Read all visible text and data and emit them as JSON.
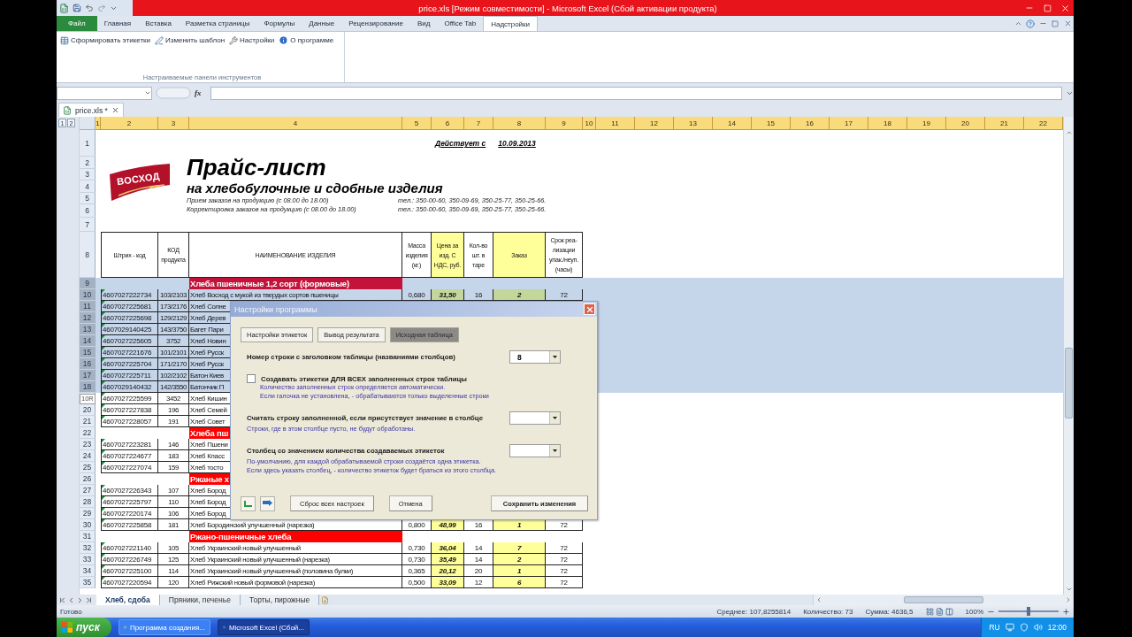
{
  "title_bar": {
    "title": "price.xls [Режим совместимости] - Microsoft Excel (Сбой активации продукта)"
  },
  "ribbon": {
    "tabs": [
      {
        "label": "Файл",
        "kind": "file",
        "selected": false
      },
      {
        "label": "Главная",
        "kind": "tab",
        "selected": false
      },
      {
        "label": "Вставка",
        "kind": "tab",
        "selected": false
      },
      {
        "label": "Разметка страницы",
        "kind": "tab",
        "selected": false
      },
      {
        "label": "Формулы",
        "kind": "tab",
        "selected": false
      },
      {
        "label": "Данные",
        "kind": "tab",
        "selected": false
      },
      {
        "label": "Рецензирование",
        "kind": "tab",
        "selected": false
      },
      {
        "label": "Вид",
        "kind": "tab",
        "selected": false
      },
      {
        "label": "Office Tab",
        "kind": "tab",
        "selected": false
      },
      {
        "label": "Надстройки",
        "kind": "tab",
        "selected": true
      }
    ],
    "commands": [
      {
        "label": "Сформировать этикетки",
        "kind": "table"
      },
      {
        "label": "Изменить шаблон",
        "kind": "edit"
      },
      {
        "label": "Настройки",
        "kind": "settings"
      },
      {
        "label": "О программе",
        "kind": "info"
      }
    ],
    "group_label": "Настраиваемые панели инструментов"
  },
  "formula_bar": {
    "function_label": "fx"
  },
  "doc_tabs": [
    {
      "label": "price.xls *",
      "selected": true
    }
  ],
  "sheet": {
    "outline_levels": [
      "1",
      "2"
    ],
    "columns": [
      "1",
      "2",
      "3",
      "4",
      "5",
      "6",
      "7",
      "8",
      "9",
      "10",
      "11",
      "12",
      "13",
      "14",
      "15",
      "16",
      "17",
      "18",
      "19",
      "20",
      "21",
      "22"
    ],
    "header_block": {
      "row_numbers": [
        "1",
        "2",
        "3",
        "4",
        "5",
        "6",
        "7"
      ],
      "effective_label": "Действует с",
      "effective_date": "10.09.2013",
      "logo_text": "ВОСХОД",
      "title": "Прайс-лист",
      "subtitle": "на хлебобулочные и сдобные изделия",
      "info_lines": [
        {
          "text": "Прием заказов на продукцию (с 08.00 до 18.00)",
          "phones": "тел.: 350-00-60, 350-09-69, 350-25-77, 350-25-66."
        },
        {
          "text": "Корректировка заказов на продукцию (с 08.00 до 18.00)",
          "phones": "тел.: 350-00-60, 350-09-69, 350-25-77, 350-25-66."
        }
      ]
    },
    "table_header": {
      "row_number": "8",
      "cells": [
        "Штрих - код",
        "КОД продукта",
        "НАИМЕНОВАНИЕ ИЗДЕЛИЯ",
        "Масса изделия (кг.)",
        "Цена за изд. С НДС, руб.",
        "Кол-во шт. в таре",
        "Заказ",
        "Срок реа-лизации упак./неуп. (часы)"
      ]
    },
    "rows": [
      {
        "number": "9",
        "selected": true,
        "kind": "category",
        "name": "Хлеба пшеничные 1,2 сорт (формовые)"
      },
      {
        "number": "10",
        "selected": true,
        "kind": "item",
        "barcode": "4607027222734",
        "code": "103/2103",
        "name": "Хлеб Восход с мукой из твердых сортов пшеницы",
        "mass": "0,680",
        "price": "31,50",
        "pack": "16",
        "order": "2",
        "shelf_life": "72"
      },
      {
        "number": "11",
        "selected": true,
        "kind": "item",
        "barcode": "4607027225681",
        "code": "173/2176",
        "name": "Хлеб Солне"
      },
      {
        "number": "12",
        "selected": true,
        "kind": "item",
        "barcode": "4607027225698",
        "code": "129/2129",
        "name": "Хлеб Дерев"
      },
      {
        "number": "13",
        "selected": true,
        "kind": "item",
        "barcode": "4607029140425",
        "code": "143/3750",
        "name": "Багет Пари"
      },
      {
        "number": "14",
        "selected": true,
        "kind": "item",
        "barcode": "4607027225605",
        "code": "3752",
        "name": "Хлеб Новин"
      },
      {
        "number": "15",
        "selected": true,
        "kind": "item",
        "barcode": "4607027221676",
        "code": "101/2101",
        "name": "Хлеб Русск"
      },
      {
        "number": "16",
        "selected": true,
        "kind": "item",
        "barcode": "4607027225704",
        "code": "171/2170",
        "name": "Хлеб Русск"
      },
      {
        "number": "17",
        "selected": true,
        "kind": "item",
        "barcode": "4607027225711",
        "code": "102/2102",
        "name": "Батон Киев"
      },
      {
        "number": "18",
        "selected": true,
        "kind": "item",
        "barcode": "4607029140432",
        "code": "142/3550",
        "name": "Батончик П"
      },
      {
        "tooltip": "10R",
        "selected": false,
        "kind": "item",
        "barcode": "4607027225599",
        "code": "3452",
        "name": "Хлеб Кишин"
      },
      {
        "number": "20",
        "selected": false,
        "kind": "item",
        "barcode": "4607027227838",
        "code": "196",
        "name": "Хлеб Семей"
      },
      {
        "number": "21",
        "selected": false,
        "kind": "item",
        "barcode": "4607027228057",
        "code": "191",
        "name": "Хлеб Совет"
      },
      {
        "number": "22",
        "selected": false,
        "kind": "category",
        "name": "Хлеба пш"
      },
      {
        "number": "23",
        "selected": false,
        "kind": "item",
        "barcode": "4607027223281",
        "code": "146",
        "name": "Хлеб Пшени"
      },
      {
        "number": "24",
        "selected": false,
        "kind": "item",
        "barcode": "4607027224677",
        "code": "183",
        "name": "Хлеб Класс"
      },
      {
        "number": "25",
        "selected": false,
        "kind": "item",
        "barcode": "4607027227074",
        "code": "159",
        "name": "Хлеб тосто"
      },
      {
        "number": "26",
        "selected": false,
        "kind": "category",
        "name": "Ржаные х"
      },
      {
        "number": "27",
        "selected": false,
        "kind": "item",
        "barcode": "4607027226343",
        "code": "107",
        "name": "Хлеб Бород"
      },
      {
        "number": "28",
        "selected": false,
        "kind": "item",
        "barcode": "4607027225797",
        "code": "110",
        "name": "Хлеб Бород"
      },
      {
        "number": "29",
        "selected": false,
        "kind": "item",
        "barcode": "4607027220174",
        "code": "106",
        "name": "Хлеб Бород"
      },
      {
        "number": "30",
        "selected": false,
        "kind": "item",
        "barcode": "4607027225858",
        "code": "181",
        "name": "Хлеб Бородинский улучшенный (нарезка)",
        "mass": "0,800",
        "price": "48,99",
        "pack": "16",
        "order": "1",
        "shelf_life": "72"
      },
      {
        "number": "31",
        "selected": false,
        "kind": "category",
        "name": "Ржано-пшеничные хлеба"
      },
      {
        "number": "32",
        "selected": false,
        "kind": "item",
        "barcode": "4607027221140",
        "code": "105",
        "name": "Хлеб Украинский новый улучшенный",
        "mass": "0,730",
        "price": "36,04",
        "pack": "14",
        "order": "7",
        "shelf_life": "72"
      },
      {
        "number": "33",
        "selected": false,
        "kind": "item",
        "barcode": "4607027226749",
        "code": "125",
        "name": "Хлеб Украинский новый улучшенный (нарезка)",
        "mass": "0,730",
        "price": "35,49",
        "pack": "14",
        "order": "2",
        "shelf_life": "72"
      },
      {
        "number": "34",
        "selected": false,
        "kind": "item",
        "barcode": "4607027225100",
        "code": "114",
        "name": "Хлеб Украинский новый улучшенный (половина булки)",
        "mass": "0,365",
        "price": "20,12",
        "pack": "20",
        "order": "1",
        "shelf_life": "72"
      },
      {
        "number": "35",
        "selected": false,
        "kind": "item",
        "barcode": "4607027220594",
        "code": "120",
        "name": "Хлеб Рижский новый формовой (нарезка)",
        "mass": "0,500",
        "price": "33,09",
        "pack": "12",
        "order": "6",
        "shelf_life": "72"
      }
    ]
  },
  "sheet_tabs": [
    {
      "label": "Хлеб, сдоба",
      "selected": true
    },
    {
      "label": "Пряники, печенье",
      "selected": false
    },
    {
      "label": "Торты, пирожные",
      "selected": false
    }
  ],
  "status_bar": {
    "ready": "Готово",
    "average": "Среднее: 107,8255814",
    "count": "Количество: 73",
    "sum": "Сумма: 4636,5",
    "zoom": "100%",
    "zoom_slider": {
      "level": 0.5
    }
  },
  "taskbar": {
    "start": "пуск",
    "tasks": [
      {
        "label": "Программа создания...",
        "selected": false
      },
      {
        "label": "Microsoft Excel (Сбой...",
        "selected": true
      }
    ],
    "language": "RU",
    "clock": "12:00"
  },
  "dialog": {
    "title": "Настройки программы",
    "tabs": [
      {
        "label": "Настройки этикеток",
        "selected": false
      },
      {
        "label": "Вывод результата",
        "selected": false
      },
      {
        "label": "Исходная таблица",
        "selected": true
      }
    ],
    "fields": [
      {
        "kind": "combo",
        "label": "Номер строки с заголовком таблицы (названиями столбцов)",
        "value": "8"
      },
      {
        "kind": "checkbox",
        "label": "Создавать этикетки ДЛЯ ВСЕХ заполненных строк таблицы",
        "checked": false,
        "hints": [
          "Количество заполненных строк определяется автоматически.",
          "Если галочка не установлена, - обрабатываются только выделенные строки"
        ]
      },
      {
        "kind": "combo",
        "label": "Считать строку заполненной, если присутствует значение в столбце",
        "hints": [
          "Строки, где в этом столбце пусто, не будут обработаны."
        ]
      },
      {
        "kind": "combo",
        "label": "Столбец со значением количества создаваемых этикеток",
        "hints": [
          "По-умолчанию, для каждой обрабатываемой строки создаётся одна этикетка.",
          "Если здесь указать столбец, - количество этикеток будет браться из этого столбца."
        ]
      }
    ],
    "buttons": [
      {
        "label": "Сброс всех настроек",
        "primary": false
      },
      {
        "label": "Отмена",
        "primary": false
      },
      {
        "label": "Сохранить изменения",
        "primary": true
      }
    ]
  }
}
